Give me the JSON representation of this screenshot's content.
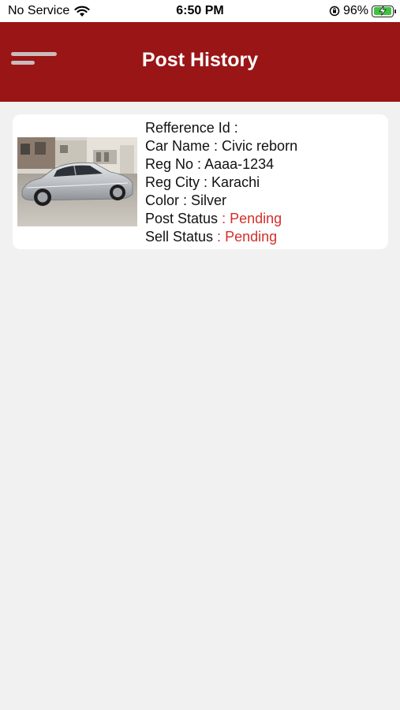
{
  "status_bar": {
    "carrier": "No Service",
    "time": "6:50 PM",
    "battery_percent": "96%",
    "battery_level": 0.96,
    "wifi_icon": "wifi-icon",
    "orientation_lock_icon": "orientation-lock-icon",
    "battery_color": "#3ec43e"
  },
  "header": {
    "title": "Post History",
    "menu_icon": "hamburger-menu-icon",
    "background_color": "#9a1516"
  },
  "posts": [
    {
      "reference_id_label": "Refference Id :",
      "car_name_label": "Car Name :",
      "car_name": "Civic reborn",
      "reg_no_label": "Reg No :",
      "reg_no": "Aaaa-1234",
      "reg_city_label": "Reg City :",
      "reg_city": "Karachi",
      "color_label": "Color :",
      "color": "Silver",
      "post_status_label": "Post Status",
      "post_status_sep": " : ",
      "post_status": "Pending",
      "sell_status_label": "Sell Status",
      "sell_status_sep": " : ",
      "sell_status": "Pending",
      "status_color": "#d42f2a"
    }
  ]
}
